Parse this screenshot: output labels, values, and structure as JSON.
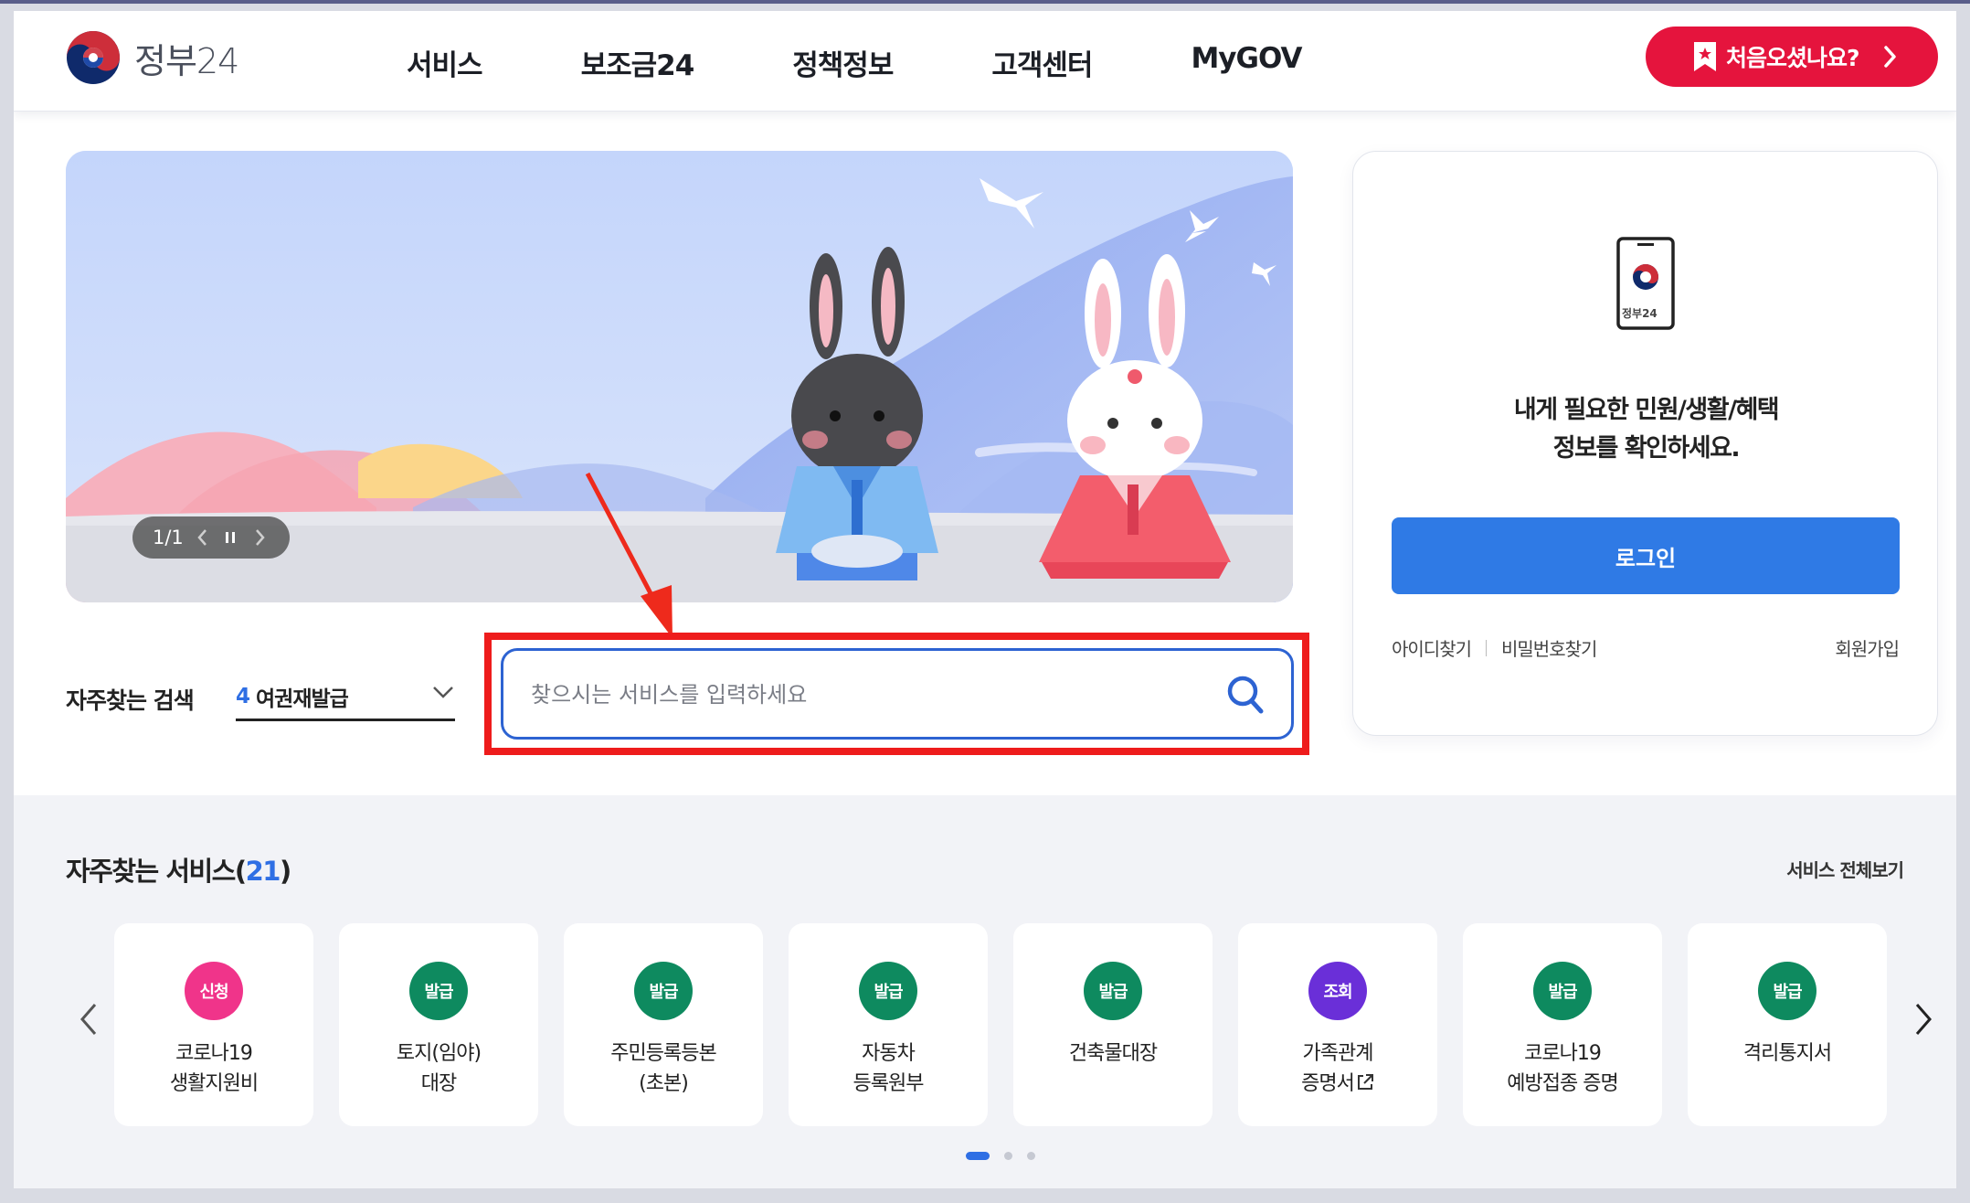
{
  "header": {
    "logo_text": "정부24",
    "nav": [
      "서비스",
      "보조금24",
      "정책정보",
      "고객센터",
      "MyGOV"
    ],
    "first_visit_label": "처음오셨나요?"
  },
  "banner": {
    "slide_counter": "1/1"
  },
  "search": {
    "frequent_label": "자주찾는 검색",
    "frequent_rank": "4",
    "frequent_keyword": "여권재발급",
    "placeholder": "찾으시는 서비스를 입력하세요"
  },
  "login": {
    "phone_logo_text": "정부24",
    "message_line1": "내게 필요한 민원/생활/혜택",
    "message_line2": "정보를 확인하세요.",
    "login_label": "로그인",
    "find_id": "아이디찾기",
    "find_pw": "비밀번호찾기",
    "signup": "회원가입"
  },
  "services": {
    "title_prefix": "자주찾는 서비스(",
    "count": "21",
    "title_suffix": ")",
    "view_all": "서비스 전체보기",
    "items": [
      {
        "badge": "신청",
        "color": "#f0348a",
        "line1": "코로나19",
        "line2": "생활지원비"
      },
      {
        "badge": "발급",
        "color": "#0e8a5f",
        "line1": "토지(임야)",
        "line2": "대장"
      },
      {
        "badge": "발급",
        "color": "#0e8a5f",
        "line1": "주민등록등본",
        "line2": "(초본)"
      },
      {
        "badge": "발급",
        "color": "#0e8a5f",
        "line1": "자동차",
        "line2": "등록원부"
      },
      {
        "badge": "발급",
        "color": "#0e8a5f",
        "line1": "건축물대장",
        "line2": ""
      },
      {
        "badge": "조회",
        "color": "#6a2fd8",
        "line1": "가족관계",
        "line2": "증명서"
      },
      {
        "badge": "발급",
        "color": "#0e8a5f",
        "line1": "코로나19",
        "line2": "예방접종 증명"
      },
      {
        "badge": "발급",
        "color": "#0e8a5f",
        "line1": "격리통지서",
        "line2": ""
      }
    ]
  },
  "colors": {
    "accent_blue": "#2f7ae5",
    "brand_red": "#e5143d",
    "highlight_red": "#ee1c1c"
  }
}
